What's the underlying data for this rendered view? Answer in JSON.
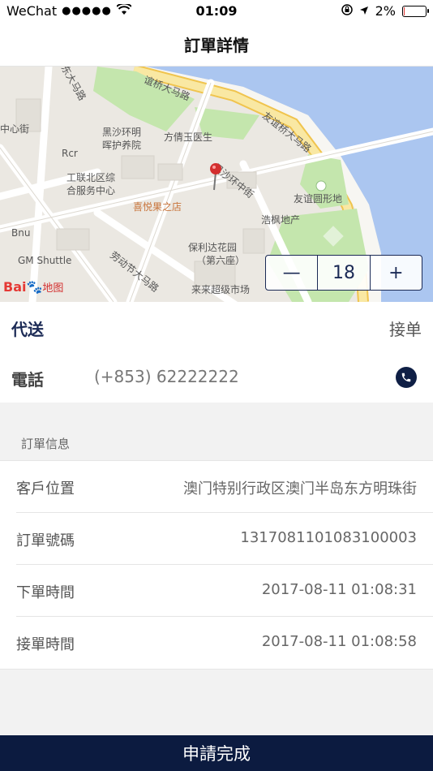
{
  "status_bar": {
    "carrier": "WeChat",
    "signal": "●●●●●",
    "time": "01:09",
    "battery": "2%",
    "battery_level": 0.02
  },
  "header": {
    "title": "訂單詳情"
  },
  "map": {
    "labels": [
      "场东大马路",
      "中心街",
      "黑沙环明",
      "晖护养院",
      "方倩玉医生",
      "友谊桥大马路",
      "Rcr",
      "工联北区综",
      "合服务中心",
      "黑沙环中街",
      "友谊圆形地",
      "喜悦果之店",
      "浩枫地产",
      "Bnu",
      "保利达花园",
      "（第六座）",
      "GM Shuttle",
      "劳动节大马路",
      "来来超级市场",
      "谊桥大马路"
    ],
    "baidu": "Bai",
    "baidu_cn": "地图",
    "zoom": {
      "minus": "—",
      "level": "18",
      "plus": "+"
    }
  },
  "order_top": {
    "delivery": "代送",
    "accept": "接单",
    "phone_label": "電話",
    "phone_value": "(+853) 62222222"
  },
  "section": {
    "title": "訂單信息"
  },
  "info_rows": [
    {
      "label": "客戶位置",
      "value": "澳门特别行政区澳门半岛东方明珠街"
    },
    {
      "label": "訂單號碼",
      "value": "1317081101083100003"
    },
    {
      "label": "下單時間",
      "value": "2017-08-11 01:08:31"
    },
    {
      "label": "接單時間",
      "value": "2017-08-11 01:08:58"
    }
  ],
  "footer": {
    "button": "申請完成"
  },
  "colors": {
    "navy": "#0c1b40",
    "water": "#abc6f0",
    "park": "#bde3a8",
    "road_main": "#f6e39a"
  }
}
